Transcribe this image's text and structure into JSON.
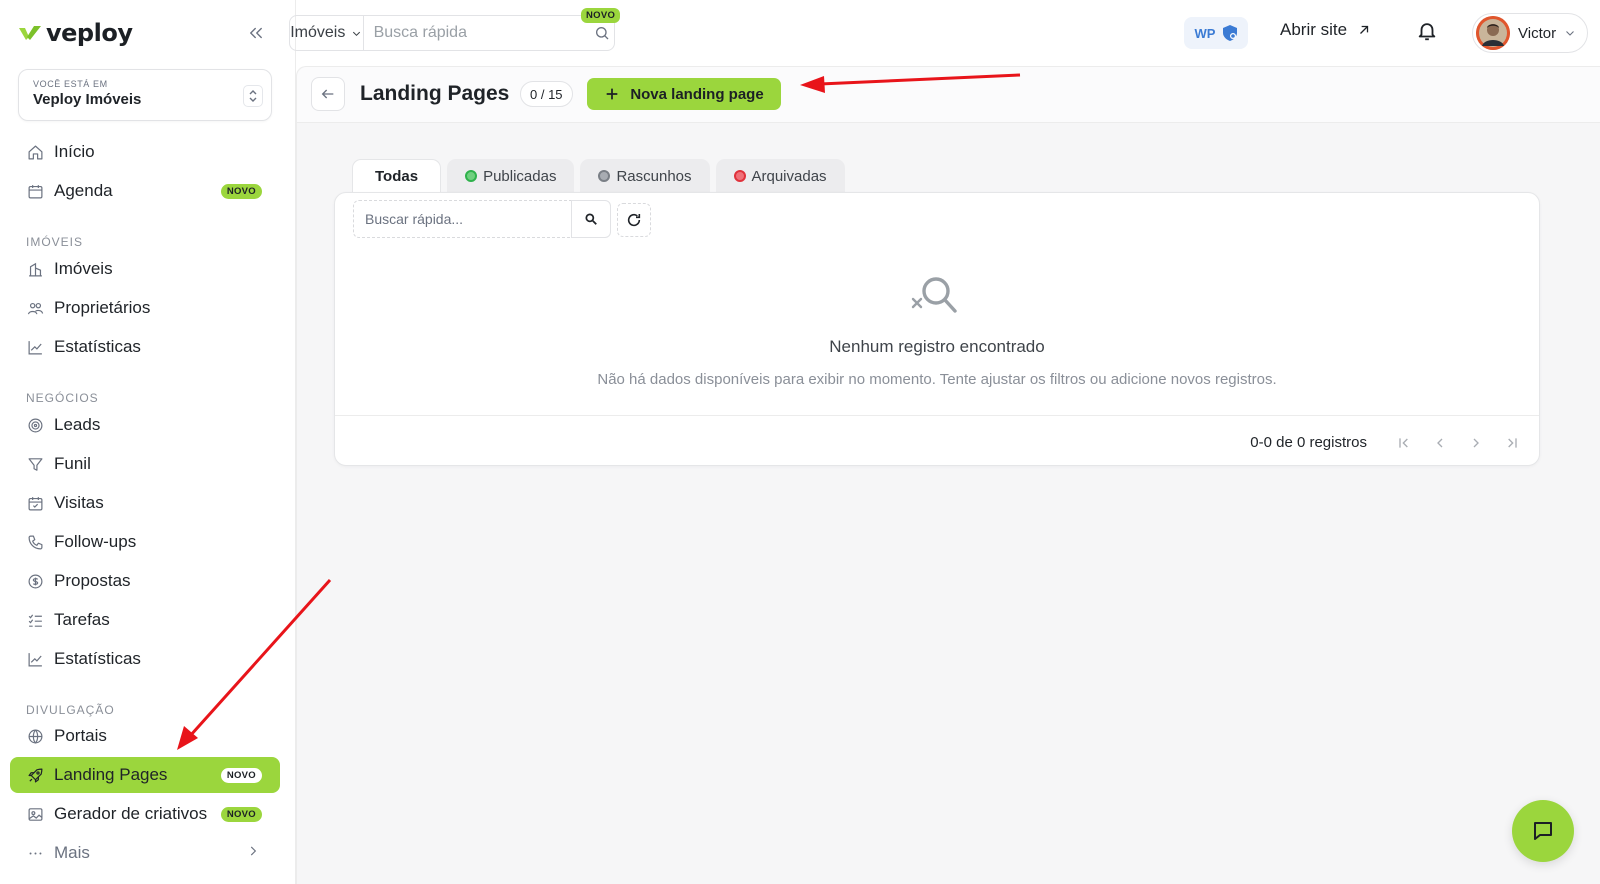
{
  "brand": {
    "logo_text": "veploy",
    "accent_color": "#9bd63d"
  },
  "sidebar": {
    "workspace_caption": "VOCÊ ESTÁ EM",
    "workspace_name": "Veploy Imóveis",
    "top_items": [
      {
        "label": "Início",
        "icon": "home-icon"
      },
      {
        "label": "Agenda",
        "icon": "calendar-icon",
        "badge": "NOVO"
      }
    ],
    "sections": [
      {
        "title": "IMÓVEIS",
        "items": [
          {
            "label": "Imóveis",
            "icon": "building-icon"
          },
          {
            "label": "Proprietários",
            "icon": "users-icon"
          },
          {
            "label": "Estatísticas",
            "icon": "chart-icon"
          }
        ]
      },
      {
        "title": "NEGÓCIOS",
        "items": [
          {
            "label": "Leads",
            "icon": "target-icon"
          },
          {
            "label": "Funil",
            "icon": "funnel-icon"
          },
          {
            "label": "Visitas",
            "icon": "calendar-check-icon"
          },
          {
            "label": "Follow-ups",
            "icon": "phone-icon"
          },
          {
            "label": "Propostas",
            "icon": "dollar-icon"
          },
          {
            "label": "Tarefas",
            "icon": "checklist-icon"
          },
          {
            "label": "Estatísticas",
            "icon": "chart-icon"
          }
        ]
      },
      {
        "title": "DIVULGAÇÃO",
        "items": [
          {
            "label": "Portais",
            "icon": "globe-icon"
          },
          {
            "label": "Landing Pages",
            "icon": "rocket-icon",
            "badge": "NOVO",
            "active": true
          },
          {
            "label": "Gerador de criativos",
            "icon": "image-icon",
            "badge": "NOVO"
          },
          {
            "label": "Mais",
            "icon": "ellipsis-icon"
          }
        ]
      }
    ]
  },
  "topbar": {
    "search_scope": "Imóveis",
    "search_placeholder": "Busca rápida",
    "search_badge": "NOVO",
    "wp_label": "WP",
    "open_site_label": "Abrir site",
    "user_name": "Victor"
  },
  "page": {
    "title": "Landing Pages",
    "counter": "0 / 15",
    "new_button_label": "Nova landing page",
    "tabs": [
      {
        "label": "Todas",
        "active": true
      },
      {
        "label": "Publicadas",
        "dot_color": "#2fb24c"
      },
      {
        "label": "Rascunhos",
        "dot_color": "#7a7f86"
      },
      {
        "label": "Arquivadas",
        "dot_color": "#e0323c"
      }
    ],
    "table_search_placeholder": "Buscar rápida...",
    "empty_title": "Nenhum registro encontrado",
    "empty_subtitle": "Não há dados disponíveis para exibir no momento. Tente ajustar os filtros ou adicione novos registros.",
    "pagination_info": "0-0 de 0 registros"
  },
  "annotations": {
    "arrow_color": "#e8141a"
  }
}
